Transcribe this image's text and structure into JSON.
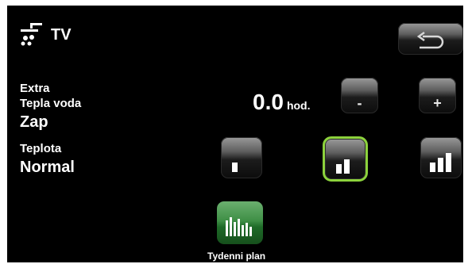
{
  "header": {
    "title": "TV",
    "icon": "shower-icon"
  },
  "extra": {
    "label_line1": "Extra",
    "label_line2": "Tepla voda",
    "state": "Zap",
    "value": "0.0",
    "unit": "hod.",
    "minus_label": "-",
    "plus_label": "+"
  },
  "temperature": {
    "label": "Teplota",
    "value": "Normal",
    "selected_level": 2,
    "levels": 3
  },
  "plan": {
    "label": "Tydenni plan",
    "icon": "bar-chart-icon"
  },
  "colors": {
    "background": "#000000",
    "text": "#ffffff",
    "selected_outline": "#8cd23c",
    "plan_button": "#3f8f46"
  }
}
